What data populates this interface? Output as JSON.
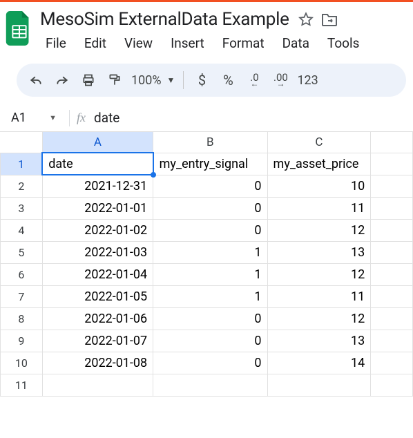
{
  "doc": {
    "title": "MesoSim ExternalData Example"
  },
  "menus": {
    "file": "File",
    "edit": "Edit",
    "view": "View",
    "insert": "Insert",
    "format": "Format",
    "data": "Data",
    "tools": "Tools"
  },
  "toolbar": {
    "zoom": "100%",
    "dollar": "$",
    "percent": "%",
    "dec_dec": ".0",
    "dec_inc": ".00",
    "numfmt": "123"
  },
  "namebox": {
    "ref": "A1",
    "formula": "date"
  },
  "columns": {
    "A": "A",
    "B": "B",
    "C": "C"
  },
  "headers": {
    "A": "date",
    "B": "my_entry_signal",
    "C": "my_asset_price"
  },
  "rows": [
    {
      "n": "1"
    },
    {
      "n": "2",
      "A": "2021-12-31",
      "B": "0",
      "C": "10"
    },
    {
      "n": "3",
      "A": "2022-01-01",
      "B": "0",
      "C": "11"
    },
    {
      "n": "4",
      "A": "2022-01-02",
      "B": "0",
      "C": "12"
    },
    {
      "n": "5",
      "A": "2022-01-03",
      "B": "1",
      "C": "13"
    },
    {
      "n": "6",
      "A": "2022-01-04",
      "B": "1",
      "C": "12"
    },
    {
      "n": "7",
      "A": "2022-01-05",
      "B": "1",
      "C": "11"
    },
    {
      "n": "8",
      "A": "2022-01-06",
      "B": "0",
      "C": "12"
    },
    {
      "n": "9",
      "A": "2022-01-07",
      "B": "0",
      "C": "13"
    },
    {
      "n": "10",
      "A": "2022-01-08",
      "B": "0",
      "C": "14"
    },
    {
      "n": "11"
    }
  ]
}
